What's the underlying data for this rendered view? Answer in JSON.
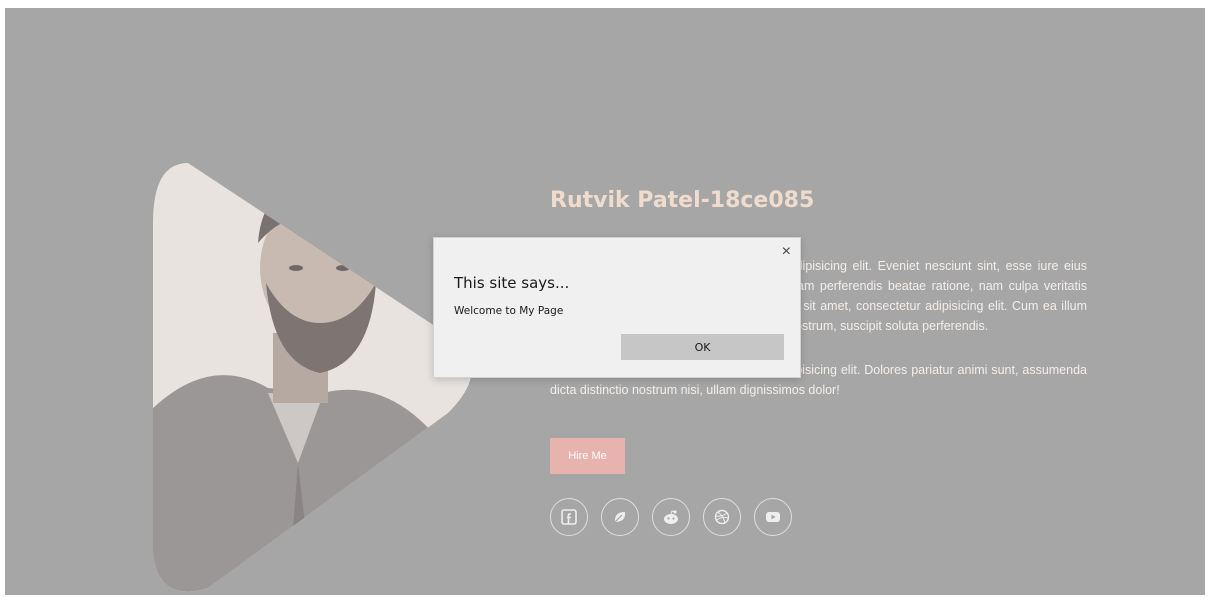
{
  "profile": {
    "name": "Rutvik Patel-18ce085",
    "paragraph1": "Lorem ipsum dolor sit amet, consectetur adipisicing elit. Eveniet nesciunt sint, esse iure eius voluptatum voluptate quidem magni numquam perferendis beatae ratione, nam culpa veritatis quisquam vel illum, nihil. Lorem ipsum dolor sit amet, consectetur adipisicing elit. Cum ea illum asperiores laborum, officiis quas amet non nostrum, suscipit soluta perferendis.",
    "paragraph2": "Lorem ipsum dolor sit amet, consectetur adipisicing elit. Dolores pariatur animi sunt, assumenda dicta distinctio nostrum nisi, ullam dignissimos dolor!",
    "hire_label": "Hire Me",
    "socials": [
      {
        "icon": "facebook-icon"
      },
      {
        "icon": "leaf-icon"
      },
      {
        "icon": "reddit-icon"
      },
      {
        "icon": "dribbble-icon"
      },
      {
        "icon": "youtube-icon"
      }
    ]
  },
  "dialog": {
    "title": "This site says...",
    "message": "Welcome to My Page",
    "ok_label": "OK",
    "close_glyph": "×"
  },
  "colors": {
    "overlay": "#a6a6a6",
    "name": "#f0dccf",
    "hire_button": "#e8b2ae",
    "dialog_bg": "#f0f0f0",
    "ok_button": "#c6c6c6"
  }
}
